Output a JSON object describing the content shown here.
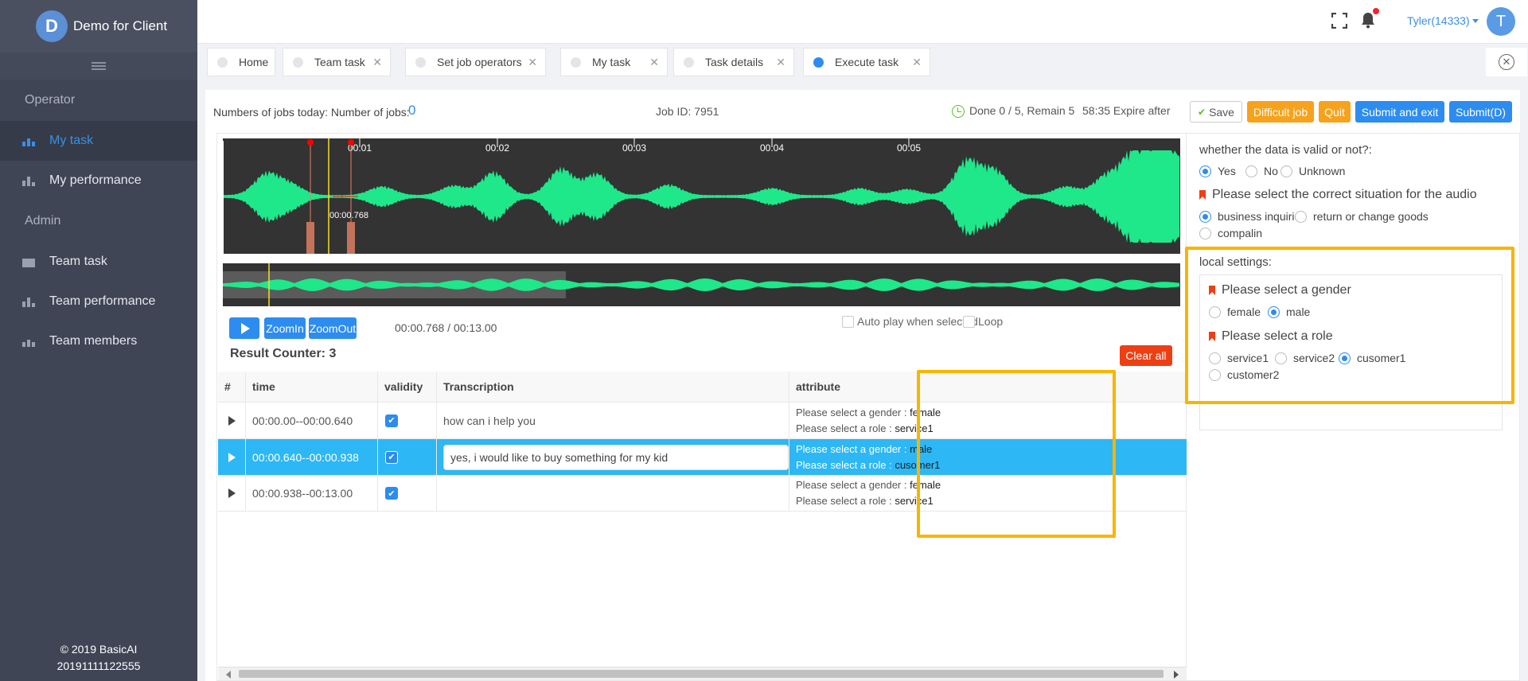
{
  "brand": {
    "initial": "D",
    "name": "Demo for Client"
  },
  "sidebar": {
    "sections": [
      {
        "title": "Operator",
        "items": [
          {
            "label": "My task",
            "active": true
          },
          {
            "label": "My performance"
          }
        ]
      },
      {
        "title": "Admin",
        "items": [
          {
            "label": "Team task"
          },
          {
            "label": "Team performance"
          },
          {
            "label": "Team members"
          }
        ]
      }
    ],
    "footer": {
      "copyright": "© 2019 BasicAI",
      "build": "20191111122555"
    }
  },
  "header": {
    "user": "Tyler(14333)",
    "avatar_initial": "T"
  },
  "tabs": [
    {
      "label": "Home",
      "closable": false
    },
    {
      "label": "Team task",
      "closable": true
    },
    {
      "label": "Set job operators",
      "closable": true
    },
    {
      "label": "My task",
      "closable": true
    },
    {
      "label": "Task details",
      "closable": true
    },
    {
      "label": "Execute task",
      "closable": true,
      "active": true
    }
  ],
  "topbar": {
    "jobs_label": "Numbers of jobs today: Number of jobs:",
    "jobs_count": "0",
    "job_id": "Job ID: 7951",
    "progress": "Done 0 / 5, Remain 5",
    "expire": "58:35 Expire after",
    "buttons": {
      "save": "Save",
      "difficult": "Difficult job",
      "quit": "Quit",
      "submit_exit": "Submit and exit",
      "submit": "Submit(D)"
    }
  },
  "waveform": {
    "ticks": [
      "00:01",
      "00:02",
      "00:03",
      "00:04",
      "00:05"
    ],
    "cursor_label": "00:00.768",
    "colors": {
      "wave": "#1ee88a",
      "background": "#333333",
      "cursor": "#f5e027",
      "marker": "#ff0000"
    }
  },
  "player": {
    "zoom_in": "ZoomIn",
    "zoom_out": "ZoomOut",
    "time": "00:00.768 / 00:13.00",
    "autoplay_label": "Auto play when selected",
    "loop_label": "Loop"
  },
  "results": {
    "counter": "Result Counter: 3",
    "clear_all": "Clear all",
    "columns": [
      "#",
      "time",
      "validity",
      "Transcription",
      "attribute"
    ],
    "rows": [
      {
        "time": "00:00.00--00:00.640",
        "valid": true,
        "transcription": "how can i help you",
        "gender_label": "Please select a gender :",
        "gender": "female",
        "role_label": "Please select a role :",
        "role": "service1"
      },
      {
        "time": "00:00.640--00:00.938",
        "valid": true,
        "transcription": "yes, i would like to buy something for my kid",
        "gender_label": "Please select a gender :",
        "gender": "male",
        "role_label": "Please select a role :",
        "role": "cusomer1",
        "selected": true
      },
      {
        "time": "00:00.938--00:13.00",
        "valid": true,
        "transcription": "",
        "gender_label": "Please select a gender :",
        "gender": "female",
        "role_label": "Please select a role :",
        "role": "service1"
      }
    ]
  },
  "right_panel": {
    "q1": {
      "label": "whether the data is valid or not?:",
      "options": [
        "Yes",
        "No",
        "Unknown"
      ],
      "selected": "Yes"
    },
    "q2": {
      "label": "Please select the correct situation for the audio",
      "options": [
        "business inquiries",
        "return or change goods",
        "compalin"
      ],
      "selected": "business inquiries"
    },
    "local": {
      "title": "local settings:",
      "gender": {
        "label": "Please select a gender",
        "options": [
          "female",
          "male"
        ],
        "selected": "male"
      },
      "role": {
        "label": "Please select a role",
        "options": [
          "service1",
          "service2",
          "cusomer1",
          "customer2"
        ],
        "selected": "cusomer1"
      }
    }
  }
}
